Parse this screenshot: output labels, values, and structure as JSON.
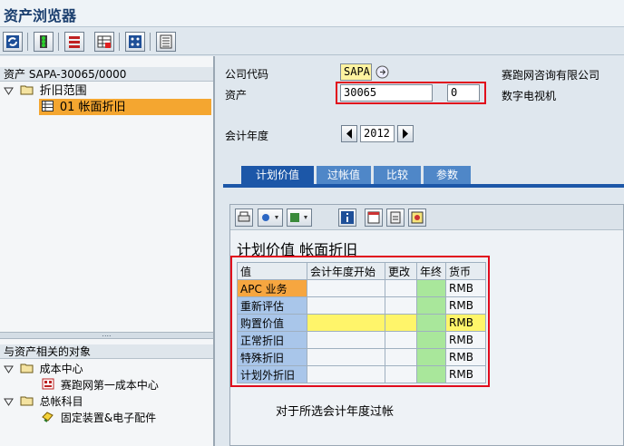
{
  "window": {
    "title": "资产浏览器"
  },
  "toolbar": {
    "buttons": [
      "refresh-icon",
      "traffic-light-icon",
      "stack-icon",
      "grid-select-icon",
      "matrix-icon",
      "list-icon"
    ]
  },
  "left": {
    "asset_header": "资产 SAPA-30065/0000",
    "tree1": [
      {
        "label": "折旧范围"
      },
      {
        "label": "01  帐面折旧"
      }
    ],
    "related_header": "与资产相关的对象",
    "tree2": [
      {
        "label": "成本中心"
      },
      {
        "label": "赛跑网第一成本中心"
      },
      {
        "label": "总帐科目"
      },
      {
        "label": "固定装置&电子配件"
      }
    ]
  },
  "header": {
    "company_label": "公司代码",
    "company_value": "SAPA",
    "company_name": "赛跑网咨询有限公司",
    "asset_label": "资产",
    "asset_number": "30065",
    "asset_sub": "0",
    "asset_desc": "数字电视机",
    "fiscal_year_label": "会计年度",
    "fiscal_year": "2012"
  },
  "tabs": [
    "计划价值",
    "过帐值",
    "比较",
    "参数"
  ],
  "panel": {
    "title": "计划价值 帐面折旧",
    "columns": [
      "值",
      "会计年度开始",
      "更改",
      "年终",
      "货币"
    ],
    "rows": [
      {
        "label": "APC 业务",
        "currency": "RMB"
      },
      {
        "label": "重新评估",
        "currency": "RMB"
      },
      {
        "label": "购置价值",
        "currency": "RMB"
      },
      {
        "label": "正常折旧",
        "currency": "RMB"
      },
      {
        "label": "特殊折旧",
        "currency": "RMB"
      },
      {
        "label": "计划外折旧",
        "currency": "RMB"
      }
    ],
    "footer": "对于所选会计年度过帐"
  },
  "colors": {
    "accent": "#1c57a8",
    "highlight": "#e10b1c",
    "selection": "#f4a630"
  }
}
